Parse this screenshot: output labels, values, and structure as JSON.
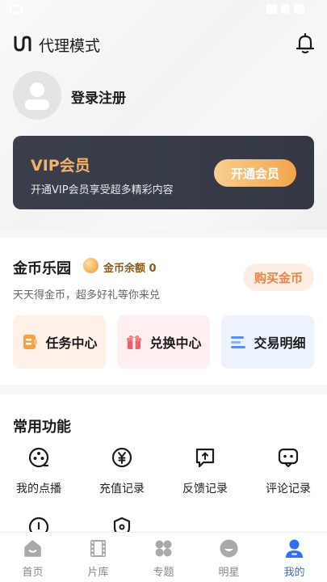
{
  "header": {
    "title": "代理模式",
    "logo_icon": "brand-logo-icon",
    "bell_icon": "bell-icon"
  },
  "profile": {
    "login_label": "登录注册",
    "avatar_icon": "user-avatar-icon"
  },
  "vip": {
    "title": "VIP会员",
    "description": "开通VIP会员享受超多精彩内容",
    "button_label": "开通会员"
  },
  "coins": {
    "title": "金币乐园",
    "balance_label": "金币余额 0",
    "description": "天天得金币，超多好礼等你来兑",
    "buy_label": "购买金币",
    "cards": [
      {
        "label": "任务中心",
        "icon": "task-icon"
      },
      {
        "label": "兑换中心",
        "icon": "gift-icon"
      },
      {
        "label": "交易明细",
        "icon": "list-icon"
      }
    ]
  },
  "functions": {
    "title": "常用功能",
    "items": [
      {
        "label": "我的点播",
        "icon": "play-icon"
      },
      {
        "label": "充值记录",
        "icon": "yuan-icon"
      },
      {
        "label": "反馈记录",
        "icon": "feedback-icon"
      },
      {
        "label": "评论记录",
        "icon": "comment-icon"
      }
    ]
  },
  "tabs": [
    {
      "label": "首页",
      "icon": "home-icon"
    },
    {
      "label": "片库",
      "icon": "film-icon"
    },
    {
      "label": "专题",
      "icon": "topics-icon"
    },
    {
      "label": "明星",
      "icon": "star-face-icon"
    },
    {
      "label": "我的",
      "icon": "profile-icon",
      "active": true
    }
  ],
  "colors": {
    "accent": "#2f6ef5",
    "vip_gold": "#f0b36a",
    "coin_orange": "#e8854a"
  }
}
